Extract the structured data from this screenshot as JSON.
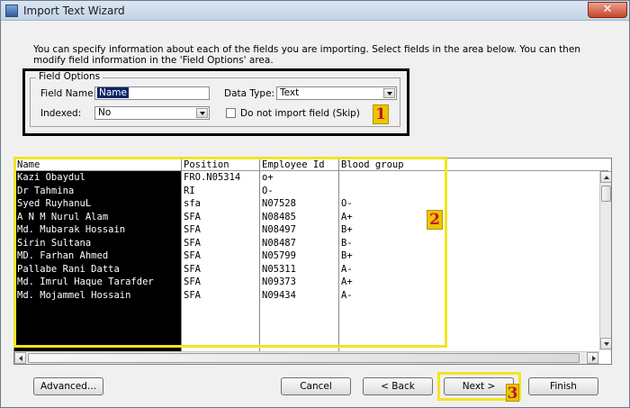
{
  "window": {
    "title": "Import Text Wizard",
    "close_label": "✕"
  },
  "intro_text": "You can specify information about each of the fields you are importing.  Select fields in the area below. You can then modify field information in the 'Field Options' area.",
  "field_options": {
    "legend": "Field Options",
    "field_name_label": "Field Name:",
    "field_name_value": "Name",
    "data_type_label": "Data Type:",
    "data_type_value": "Text",
    "indexed_label": "Indexed:",
    "indexed_value": "No",
    "skip_label": "Do not import field (Skip)",
    "skip_checked": false
  },
  "annotations": {
    "badge1": "1",
    "badge2": "2",
    "badge3": "3",
    "highlight_color": "#f2e423",
    "badge_color": "#e8c600"
  },
  "grid": {
    "columns": [
      "Name",
      "Position",
      "Employee Id",
      "Blood group"
    ],
    "rows": [
      [
        "Kazi Obaydul",
        "FRO.N05314",
        "o+",
        ""
      ],
      [
        "Dr Tahmina",
        "RI",
        "O-",
        ""
      ],
      [
        "Syed RuyhanuL",
        "sfa",
        "N07528",
        "O-"
      ],
      [
        "A N M Nurul Alam",
        "SFA",
        "N08485",
        "A+"
      ],
      [
        "Md. Mubarak Hossain",
        "SFA",
        "N08497",
        "B+"
      ],
      [
        "Sirin Sultana",
        "SFA",
        "N08487",
        "B-"
      ],
      [
        "MD. Farhan Ahmed",
        "SFA",
        "N05799",
        "B+"
      ],
      [
        "Pallabe Rani Datta",
        "SFA",
        "N05311",
        "A-"
      ],
      [
        "Md. Imrul Haque Tarafder",
        "SFA",
        "N09373",
        "A+"
      ],
      [
        "Md. Mojammel Hossain",
        "SFA",
        "N09434",
        "A-"
      ]
    ]
  },
  "buttons": {
    "advanced": "Advanced...",
    "cancel": "Cancel",
    "back": "< Back",
    "next": "Next >",
    "finish": "Finish"
  },
  "icons": {
    "app": "import-wizard-icon",
    "dropdown": "chevron-down-icon"
  }
}
